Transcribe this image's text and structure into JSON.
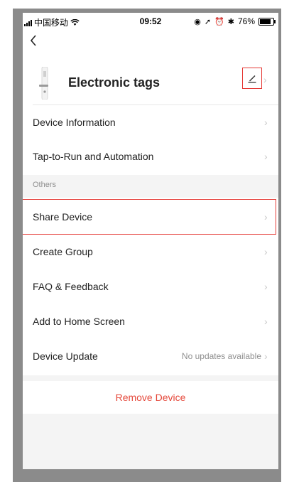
{
  "status_bar": {
    "carrier": "中国移动",
    "time": "09:52",
    "battery": "76%"
  },
  "header": {
    "device_name": "Electronic tags"
  },
  "menu_primary": [
    {
      "label": "Device Information"
    },
    {
      "label": "Tap-to-Run and Automation"
    }
  ],
  "section_others": {
    "title": "Others",
    "items": [
      {
        "label": "Share Device"
      },
      {
        "label": "Create Group"
      },
      {
        "label": "FAQ & Feedback"
      },
      {
        "label": "Add to Home Screen"
      },
      {
        "label": "Device Update",
        "value": "No updates available"
      }
    ]
  },
  "actions": {
    "remove_label": "Remove Device"
  },
  "colors": {
    "highlight": "#e53935",
    "remove_text": "#e5483b",
    "section_bg": "#f4f4f4",
    "frame": "#8b8b8b"
  },
  "battery_level": 0.76
}
